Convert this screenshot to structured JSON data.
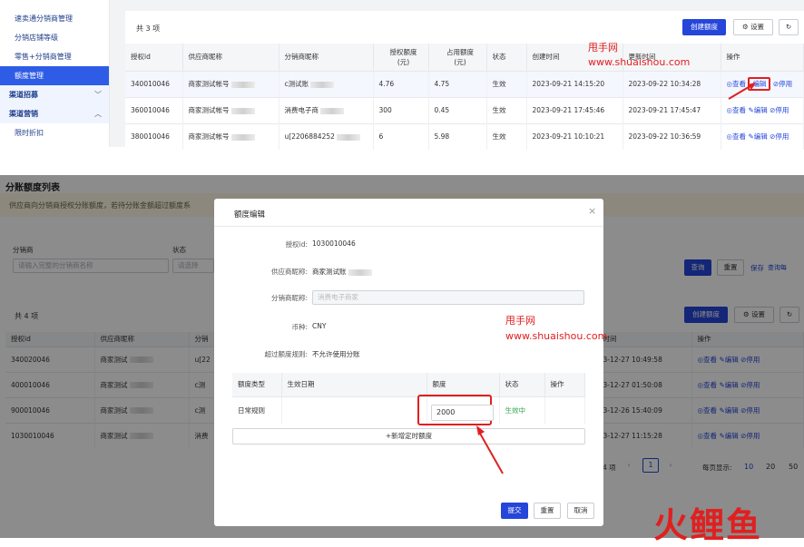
{
  "sidebar": {
    "items": [
      {
        "label": "速卖通分销商管理",
        "type": "sub"
      },
      {
        "label": "分销店铺等级",
        "type": "sub"
      },
      {
        "label": "零售+分销商管理",
        "type": "sub"
      },
      {
        "label": "额度管理",
        "type": "active"
      },
      {
        "label": "渠道招募",
        "type": "group",
        "chevron": "chevron-down"
      },
      {
        "label": "渠道营销",
        "type": "group",
        "chevron": "chevron-up"
      },
      {
        "label": "限时折扣",
        "type": "sub"
      }
    ]
  },
  "top": {
    "count_label": "共 3 项",
    "create_button": "创建额度",
    "settings_button": "设置",
    "columns": [
      "授权id",
      "供应商昵称",
      "分销商昵称",
      "授权额度\n(元)",
      "占用额度\n(元)",
      "状态",
      "创建时间",
      "更新时间",
      "操作"
    ],
    "rows": [
      {
        "id": "340010046",
        "supplier": "商家测试帐号",
        "distributor": "c测试账",
        "granted": "4.76",
        "used": "4.75",
        "status": "生效",
        "created": "2023-09-21 14:15:20",
        "updated": "2023-09-22 10:34:28"
      },
      {
        "id": "360010046",
        "supplier": "商家测试帐号",
        "distributor": "消费电子商",
        "granted": "300",
        "used": "0.45",
        "status": "生效",
        "created": "2023-09-21 17:45:46",
        "updated": "2023-09-21 17:45:47"
      },
      {
        "id": "380010046",
        "supplier": "商家测试帐号",
        "distributor": "u[2206884252",
        "granted": "6",
        "used": "5.98",
        "status": "生效",
        "created": "2023-09-21 10:10:21",
        "updated": "2023-09-22 10:36:59"
      }
    ],
    "actions": {
      "view": "查看",
      "edit": "编辑",
      "disable": "停用"
    }
  },
  "watermark": {
    "name": "甩手网",
    "url": "www.shuaishou.com"
  },
  "bottom": {
    "section_title": "分账额度列表",
    "notice": "供应商向分销商授权分账额度，若待分账金额超过额度系",
    "filter": {
      "distributor_label": "分销商",
      "distributor_placeholder": "请输入完整的分销商名称",
      "status_label": "状态",
      "status_placeholder": "请选择",
      "search_button": "查询",
      "reset_button": "重置",
      "save_button": "保存",
      "query_button": "查询每"
    },
    "count_label": "共 4 项",
    "create_button": "创建额度",
    "settings_button": "设置",
    "columns": [
      "授权id",
      "供应商昵称",
      "分销",
      "时间",
      "操作"
    ],
    "rows": [
      {
        "id": "340020046",
        "supplier": "商家测试",
        "distributor": "u[22",
        "time": "3-12-27 10:49:58"
      },
      {
        "id": "400010046",
        "supplier": "商家测试",
        "distributor": "c测",
        "time": "3-12-27 01:50:08"
      },
      {
        "id": "900010046",
        "supplier": "商家测试",
        "distributor": "c测",
        "time": "3-12-26 15:40:09"
      },
      {
        "id": "1030010046",
        "supplier": "商家测试",
        "distributor": "消费",
        "time": "3-12-27 11:15:28"
      }
    ],
    "pagination": {
      "total_suffix": "4 项",
      "current_page": "1",
      "page_size_label": "每页显示:",
      "sizes": [
        "10",
        "20",
        "50"
      ]
    }
  },
  "modal": {
    "title": "额度编辑",
    "fields": {
      "auth_id_label": "授权id:",
      "auth_id": "1030010046",
      "supplier_label": "供应商昵称:",
      "supplier": "商家测试账",
      "distributor_label": "分销商昵称:",
      "distributor": "消费电子商家",
      "currency_label": "币种:",
      "currency": "CNY",
      "over_rule_label": "超过额度规则:",
      "over_rule": "不允许使用分账"
    },
    "table": {
      "columns": [
        "额度类型",
        "生效日期",
        "额度",
        "状态",
        "操作"
      ],
      "row": {
        "type": "日常规则",
        "date": "",
        "amount": "2000",
        "status": "生效中"
      }
    },
    "add_timed_button": "+新增定时额度",
    "submit_button": "提交",
    "reset_button": "重置",
    "cancel_button": "取消"
  },
  "logo_text": "火鲤鱼",
  "colors": {
    "primary": "#2546d9",
    "red": "#e02020",
    "green": "#2ea44f"
  }
}
